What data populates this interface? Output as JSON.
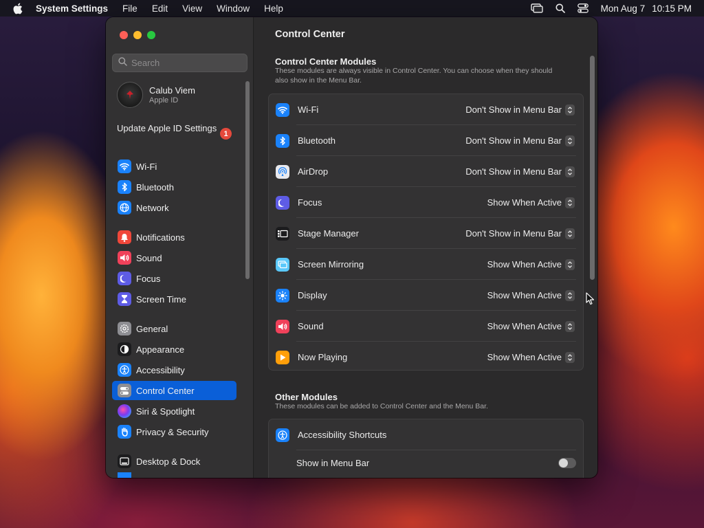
{
  "menubar": {
    "app_name": "System Settings",
    "menus": [
      "File",
      "Edit",
      "View",
      "Window",
      "Help"
    ],
    "date": "Mon Aug 7",
    "time": "10:15 PM",
    "icons": [
      "apple-icon",
      "screen-mirroring-icon",
      "spotlight-search-icon",
      "control-center-icon"
    ]
  },
  "sidebar": {
    "search_placeholder": "Search",
    "account": {
      "name": "Calub Viem",
      "subtitle": "Apple ID"
    },
    "update": {
      "label": "Update Apple ID Settings",
      "badge": "1"
    },
    "items": [
      {
        "label": "Wi-Fi",
        "icon": "wifi-icon",
        "color": "#1a82fb"
      },
      {
        "label": "Bluetooth",
        "icon": "bluetooth-icon",
        "color": "#1a82fb"
      },
      {
        "label": "Network",
        "icon": "globe-icon",
        "color": "#1a82fb"
      },
      {
        "label": "Notifications",
        "icon": "bell-icon",
        "color": "#f0473a"
      },
      {
        "label": "Sound",
        "icon": "speaker-icon",
        "color": "#f0415a"
      },
      {
        "label": "Focus",
        "icon": "moon-icon",
        "color": "#5e5ce6"
      },
      {
        "label": "Screen Time",
        "icon": "hourglass-icon",
        "color": "#5e5ce6"
      },
      {
        "label": "General",
        "icon": "gear-icon",
        "color": "#8e8e93"
      },
      {
        "label": "Appearance",
        "icon": "appearance-icon",
        "color": "#1c1c1e"
      },
      {
        "label": "Accessibility",
        "icon": "accessibility-icon",
        "color": "#1a82fb"
      },
      {
        "label": "Control Center",
        "icon": "control-center-icon",
        "color": "#8e8e93",
        "active": true
      },
      {
        "label": "Siri & Spotlight",
        "icon": "siri-icon",
        "color": "#c044d6"
      },
      {
        "label": "Privacy & Security",
        "icon": "hand-icon",
        "color": "#1a82fb"
      },
      {
        "label": "Desktop & Dock",
        "icon": "dock-icon",
        "color": "#1c1c1e"
      }
    ]
  },
  "main": {
    "title": "Control Center",
    "modules_section": {
      "title": "Control Center Modules",
      "description": "These modules are always visible in Control Center. You can choose when they should also show in the Menu Bar.",
      "rows": [
        {
          "label": "Wi-Fi",
          "icon": "wifi-icon",
          "color": "#1a82fb",
          "value": "Don't Show in Menu Bar"
        },
        {
          "label": "Bluetooth",
          "icon": "bluetooth-icon",
          "color": "#1a82fb",
          "value": "Don't Show in Menu Bar"
        },
        {
          "label": "AirDrop",
          "icon": "airdrop-icon",
          "color": "#e9e9ee",
          "value": "Don't Show in Menu Bar"
        },
        {
          "label": "Focus",
          "icon": "moon-icon",
          "color": "#5e5ce6",
          "value": "Show When Active"
        },
        {
          "label": "Stage Manager",
          "icon": "stage-manager-icon",
          "color": "#1c1c1e",
          "value": "Don't Show in Menu Bar"
        },
        {
          "label": "Screen Mirroring",
          "icon": "screen-mirroring-icon",
          "color": "#5ac8fa",
          "value": "Show When Active"
        },
        {
          "label": "Display",
          "icon": "sun-icon",
          "color": "#1a82fb",
          "value": "Show When Active"
        },
        {
          "label": "Sound",
          "icon": "speaker-icon",
          "color": "#f0415a",
          "value": "Show When Active"
        },
        {
          "label": "Now Playing",
          "icon": "play-icon",
          "color": "#ff9f0a",
          "value": "Show When Active"
        }
      ]
    },
    "other_section": {
      "title": "Other Modules",
      "description": "These modules can be added to Control Center and the Menu Bar.",
      "accessibility_shortcuts": {
        "label": "Accessibility Shortcuts",
        "icon": "accessibility-icon",
        "color": "#1a82fb"
      },
      "show_in_menu_bar": {
        "label": "Show in Menu Bar",
        "enabled": false
      }
    }
  }
}
